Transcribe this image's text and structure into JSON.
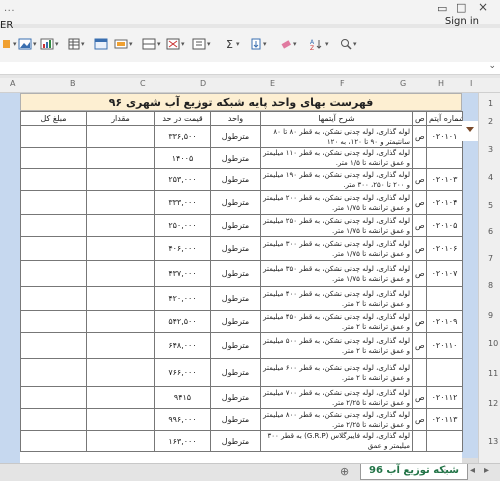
{
  "window": {
    "title": "...",
    "signin": "Sign in",
    "ribbon_fragment": "ER",
    "restore": "▭"
  },
  "columns": [
    "A",
    "B",
    "C",
    "D",
    "E",
    "F",
    "G",
    "H",
    "I"
  ],
  "rows": [
    "1",
    "2",
    "3",
    "4",
    "5",
    "6",
    "7",
    "8",
    "9",
    "10",
    "11",
    "12",
    "13"
  ],
  "sheet": {
    "title": "فهرست بهای واحد پایه شبکه توزیع آب شهری ۹۶",
    "headers": {
      "code": "شماره آیتم",
      "mark": "ص",
      "desc": "شرح آیتمها",
      "unit": "واحد",
      "price": "قیمت در حد",
      "qty": "مقدار",
      "total": "مبلغ کل"
    },
    "items": [
      {
        "code": "۰۲۰۱۰۱",
        "mark": "ص",
        "unit": "مترطول",
        "price": "۳۳۶,۵۰۰",
        "desc": "لوله گذاری، لوله چدنی نشکن، به قطر ۸۰ تا ۸۰ سانتیمتر و ۹۰ تا ۱۲۰، به ۱۲۰"
      },
      {
        "code": "",
        "mark": "",
        "unit": "مترطول",
        "price": "۱۴۰۰۵",
        "desc": "لوله گذاری، لوله چدنی نشکن، به قطر ۱۱۰ میلیمتر و عمق ترانشه تا ۱/۵ متر."
      },
      {
        "code": "۰۲۰۱۰۳",
        "mark": "ص",
        "unit": "مترطول",
        "price": "۲۵۳,۰۰۰",
        "desc": "لوله گذاری، لوله چدنی نشکن، به قطر ۱۹۰ میلیمتر و ۲۰۰ تا ۲۵۰، ۳۰۰ متر."
      },
      {
        "code": "۰۲۰۱۰۴",
        "mark": "ص",
        "unit": "مترطول",
        "price": "۳۳۳,۰۰۰",
        "desc": "لوله گذاری، لوله چدنی نشکن، به قطر ۲۰۰ میلیمتر و عمق ترانشه تا ۱/۷۵ متر."
      },
      {
        "code": "۰۲۰۱۰۵",
        "mark": "ص",
        "unit": "مترطول",
        "price": "۲۵۰,۰۰۰",
        "desc": "لوله گذاری، لوله چدنی نشکن، به قطر ۲۵۰ میلیمتر و عمق ترانشه تا ۱/۷۵ متر."
      },
      {
        "code": "۰۲۰۱۰۶",
        "mark": "ص",
        "unit": "مترطول",
        "price": "۴۰۶,۰۰۰",
        "desc": "لوله گذاری، لوله چدنی نشکن، به قطر ۳۰۰ میلیمتر و عمق ترانشه تا ۱/۷۵ متر."
      },
      {
        "code": "۰۲۰۱۰۷",
        "mark": "ص",
        "unit": "مترطول",
        "price": "۴۳۷,۰۰۰",
        "desc": "لوله گذاری، لوله چدنی نشکن، به قطر ۳۵۰ میلیمتر و عمق ترانشه تا ۱/۷۵ متر."
      },
      {
        "code": "",
        "mark": "",
        "unit": "مترطول",
        "price": "۴۲۰,۰۰۰",
        "desc": "لوله گذاری، لوله چدنی نشکن، به قطر ۴۰۰ میلیمتر و عمق ترانشه تا ۲ متر."
      },
      {
        "code": "۰۲۰۱۰۹",
        "mark": "ص",
        "unit": "مترطول",
        "price": "۵۴۲,۵۰۰",
        "desc": "لوله گذاری، لوله چدنی نشکن، به قطر ۴۵۰ میلیمتر و عمق ترانشه تا ۲ متر."
      },
      {
        "code": "۰۲۰۱۱۰",
        "mark": "ص",
        "unit": "مترطول",
        "price": "۶۴۸,۰۰۰",
        "desc": "لوله گذاری، لوله چدنی نشکن، به قطر ۵۰۰ میلیمتر و عمق ترانشه تا ۲ متر."
      },
      {
        "code": "",
        "mark": "",
        "unit": "مترطول",
        "price": "۷۶۶,۰۰۰",
        "desc": "لوله گذاری، لوله چدنی نشکن، به قطر ۶۰۰ میلیمتر و عمق ترانشه تا ۲ متر."
      },
      {
        "code": "۰۲۰۱۱۲",
        "mark": "ص",
        "unit": "مترطول",
        "price": "۹۴۱۵",
        "desc": "لوله گذاری، لوله چدنی نشکن، به قطر ۷۰۰ میلیمتر و عمق ترانشه تا ۲/۲۵ متر."
      },
      {
        "code": "۰۲۰۱۱۳",
        "mark": "ص",
        "unit": "مترطول",
        "price": "۹۹۶,۰۰۰",
        "desc": "لوله گذاری، لوله چدنی نشکن، به قطر ۸۰۰ میلیمتر و عمق ترانشه تا ۲/۲۵ متر."
      },
      {
        "code": "",
        "mark": "",
        "unit": "مترطول",
        "price": "۱۶۳,۰۰۰",
        "desc": "لوله گذاری، لوله فایبرگلاس (G.R.P) به قطر ۳۰۰ میلیمتر و عمق"
      }
    ]
  },
  "tabs": {
    "active": "شبکه توزیع آب 96",
    "add": "⊕"
  }
}
